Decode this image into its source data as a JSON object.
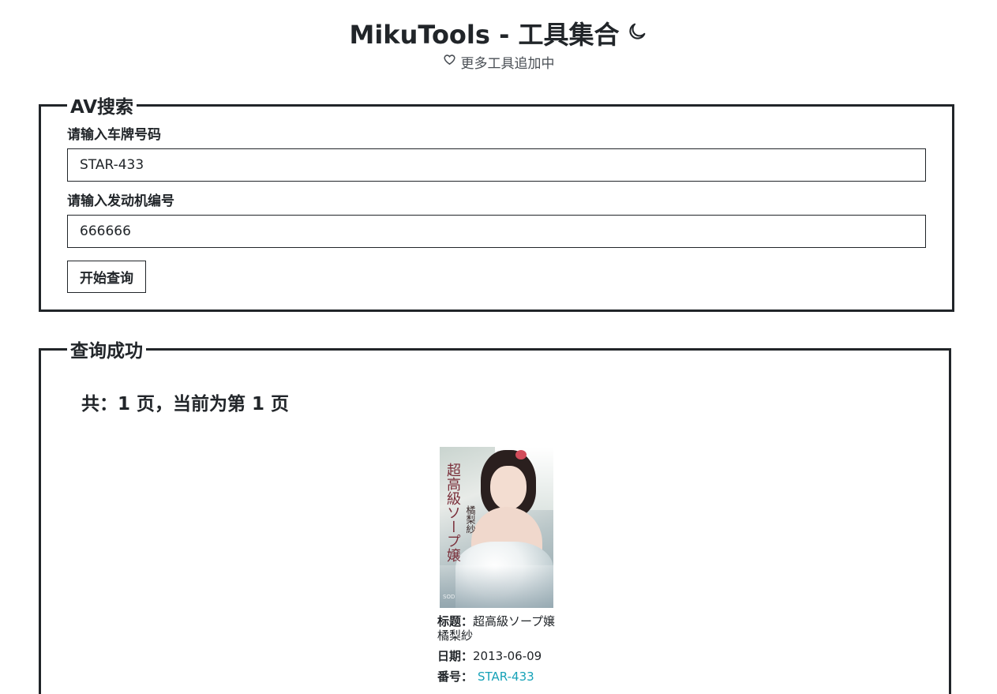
{
  "header": {
    "title": "MikuTools - 工具集合",
    "subtitle": "更多工具追加中",
    "theme_icon": "moon-icon",
    "subtitle_icon": "heart-icon"
  },
  "search_panel": {
    "legend": "AV搜索",
    "plate_label": "请输入车牌号码",
    "plate_value": "STAR-433",
    "engine_label": "请输入发动机编号",
    "engine_value": "666666",
    "submit_label": "开始查询"
  },
  "result_panel": {
    "legend": "查询成功",
    "page_info": "共：1 页，当前为第 1 页",
    "items": [
      {
        "cover_text": "超高級ソープ嬢",
        "cover_name": "橘梨紗",
        "cover_studio": "SOD",
        "title_key": "标题：",
        "title_value": "超高級ソープ嬢 橘梨紗",
        "date_key": "日期：",
        "date_value": "2013-06-09",
        "code_key": "番号：",
        "code_value": "STAR-433"
      }
    ]
  },
  "colors": {
    "text": "#212529",
    "link": "#17a2b8",
    "border": "#212529"
  }
}
